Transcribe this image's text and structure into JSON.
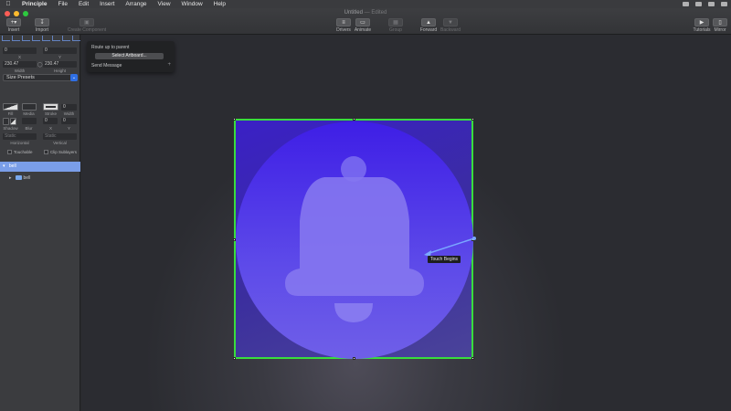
{
  "menubar": {
    "app": "Principle",
    "items": [
      "File",
      "Edit",
      "Insert",
      "Arrange",
      "View",
      "Window",
      "Help"
    ]
  },
  "window": {
    "title": "Untitled",
    "status": "— Edited"
  },
  "toolbar": {
    "insert": "Insert",
    "import": "Import",
    "create_component": "Create Component",
    "drivers": "Drivers",
    "animate": "Animate",
    "group": "Group",
    "forward": "Forward",
    "backward": "Backward",
    "tutorials": "Tutorials",
    "mirror": "Mirror"
  },
  "inspector": {
    "x_value": "0",
    "y_value": "0",
    "x_label": "X",
    "y_label": "Y",
    "width_value": "230.47",
    "height_value": "230.47",
    "width_label": "Width",
    "height_label": "Height",
    "size_presets": "Size Presets",
    "fill": "Fill",
    "media": "Media",
    "stroke": "Stroke",
    "stroke_width_value": "0",
    "stroke_width": "Width",
    "shadow": "Shadow",
    "blur": "Blur",
    "shadow_x_value": "0",
    "shadow_y_value": "0",
    "shadow_x": "X",
    "shadow_y": "Y",
    "horizontal_value": "Static",
    "vertical_value": "Static",
    "horizontal": "Horizontal",
    "vertical": "Vertical",
    "touchable": "Touchable",
    "clip_sublayers": "Clip Sublayers"
  },
  "layers": {
    "selected": "bell",
    "child": "bell"
  },
  "popup": {
    "heading": "Route up to parent",
    "select_artboard": "Select Artboard...",
    "send_message": "Send Message",
    "add": "+"
  },
  "canvas": {
    "touch_label": "Touch Begins",
    "accent_selection": "#39dd3d",
    "accent_link": "#7aa7ff"
  }
}
